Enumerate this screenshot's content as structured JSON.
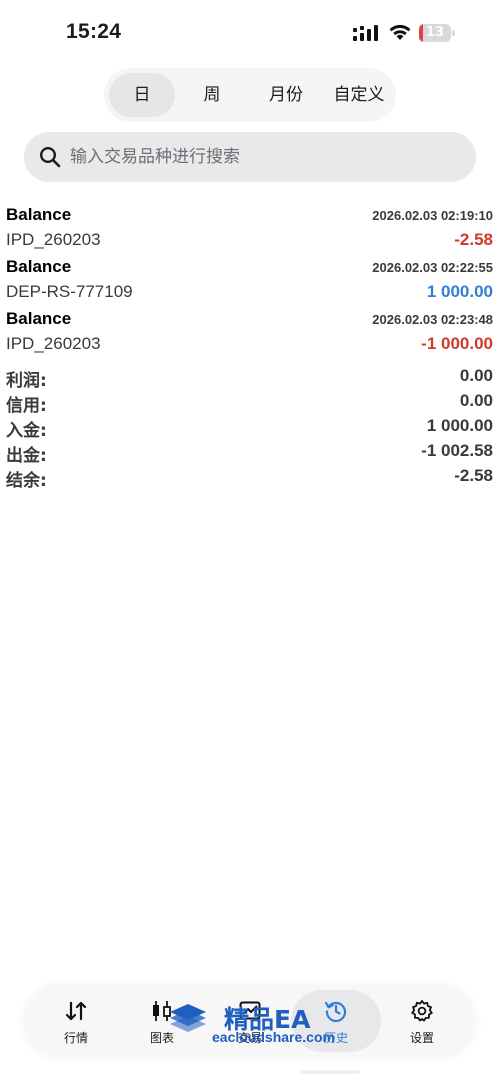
{
  "status_bar": {
    "time": "15:24",
    "battery": "13",
    "battery_level": 0.13
  },
  "period_tabs": [
    {
      "label": "日",
      "active": true
    },
    {
      "label": "周",
      "active": false
    },
    {
      "label": "月份",
      "active": false
    },
    {
      "label": "自定义",
      "active": false
    }
  ],
  "search": {
    "placeholder": "输入交易品种进行搜索",
    "value": ""
  },
  "deals": [
    {
      "type": "Balance",
      "comment": "IPD_260203",
      "time": "2026.02.03 02:19:10",
      "amount": "-2.58",
      "color": "#d1392b"
    },
    {
      "type": "Balance",
      "comment": "DEP-RS-777109",
      "time": "2026.02.03 02:22:55",
      "amount": "1 000.00",
      "color": "#2f7fd8"
    },
    {
      "type": "Balance",
      "comment": "IPD_260203",
      "time": "2026.02.03 02:23:48",
      "amount": "-1 000.00",
      "color": "#d1392b"
    }
  ],
  "summary": [
    {
      "label": "利润:",
      "value": "0.00"
    },
    {
      "label": "信用:",
      "value": "0.00"
    },
    {
      "label": "入金:",
      "value": "1 000.00"
    },
    {
      "label": "出金:",
      "value": "-1 002.58"
    },
    {
      "label": "结余:",
      "value": "-2.58"
    }
  ],
  "tab_bar": [
    {
      "label": "行情",
      "icon": "quotes-arrows-icon",
      "active": false
    },
    {
      "label": "图表",
      "icon": "candlestick-chart-icon",
      "active": false
    },
    {
      "label": "交易",
      "icon": "trade-chart-icon",
      "active": false
    },
    {
      "label": "历史",
      "icon": "history-clock-icon",
      "active": true
    },
    {
      "label": "设置",
      "icon": "gear-icon",
      "active": false
    }
  ],
  "watermark": {
    "title": "精品EA",
    "url": "eacloudshare.com"
  },
  "colors": {
    "negative": "#d1392b",
    "positive": "#2f7fd8",
    "active_tab": "#2f7fd8",
    "watermark": "#1f5fbf"
  }
}
